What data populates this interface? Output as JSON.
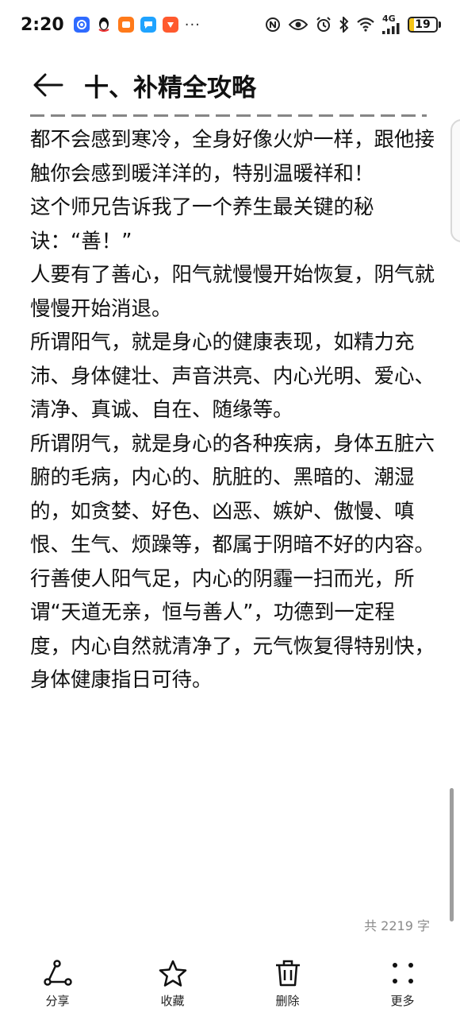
{
  "status_bar": {
    "time": "2:20",
    "more": "···",
    "network": "4G",
    "battery_level": "19",
    "battery_fraction": 0.19,
    "battery_color": "#f5c518"
  },
  "header": {
    "title": "十、补精全攻略"
  },
  "article": {
    "paragraphs": [
      "都不会感到寒冷，全身好像火炉一样，跟他接触你会感到暖洋洋的，特别温暖祥和！",
      "这个师兄告诉我了一个养生最关键的秘诀：“善！”",
      "人要有了善心，阳气就慢慢开始恢复，阴气就慢慢开始消退。",
      "所谓阳气，就是身心的健康表现，如精力充沛、身体健壮、声音洪亮、内心光明、爱心、清净、真诚、自在、随缘等。",
      "所谓阴气，就是身心的各种疾病，身体五脏六腑的毛病，内心的、肮脏的、黑暗的、潮湿的，如贪婪、好色、凶恶、嫉妒、傲慢、嗔恨、生气、烦躁等，都属于阴暗不好的内容。",
      "行善使人阳气足，内心的阴霾一扫而光，所谓“天道无亲，恒与善人”，功德到一定程度，内心自然就清净了，元气恢复得特别快，身体健康指日可待。"
    ]
  },
  "word_count": "共 2219 字",
  "toolbar": {
    "share_label": "分享",
    "favorite_label": "收藏",
    "delete_label": "删除",
    "more_label": "更多"
  },
  "colors": {
    "text": "#111111",
    "muted": "#8a8a8a",
    "scrollbar": "#9e9e9e"
  }
}
